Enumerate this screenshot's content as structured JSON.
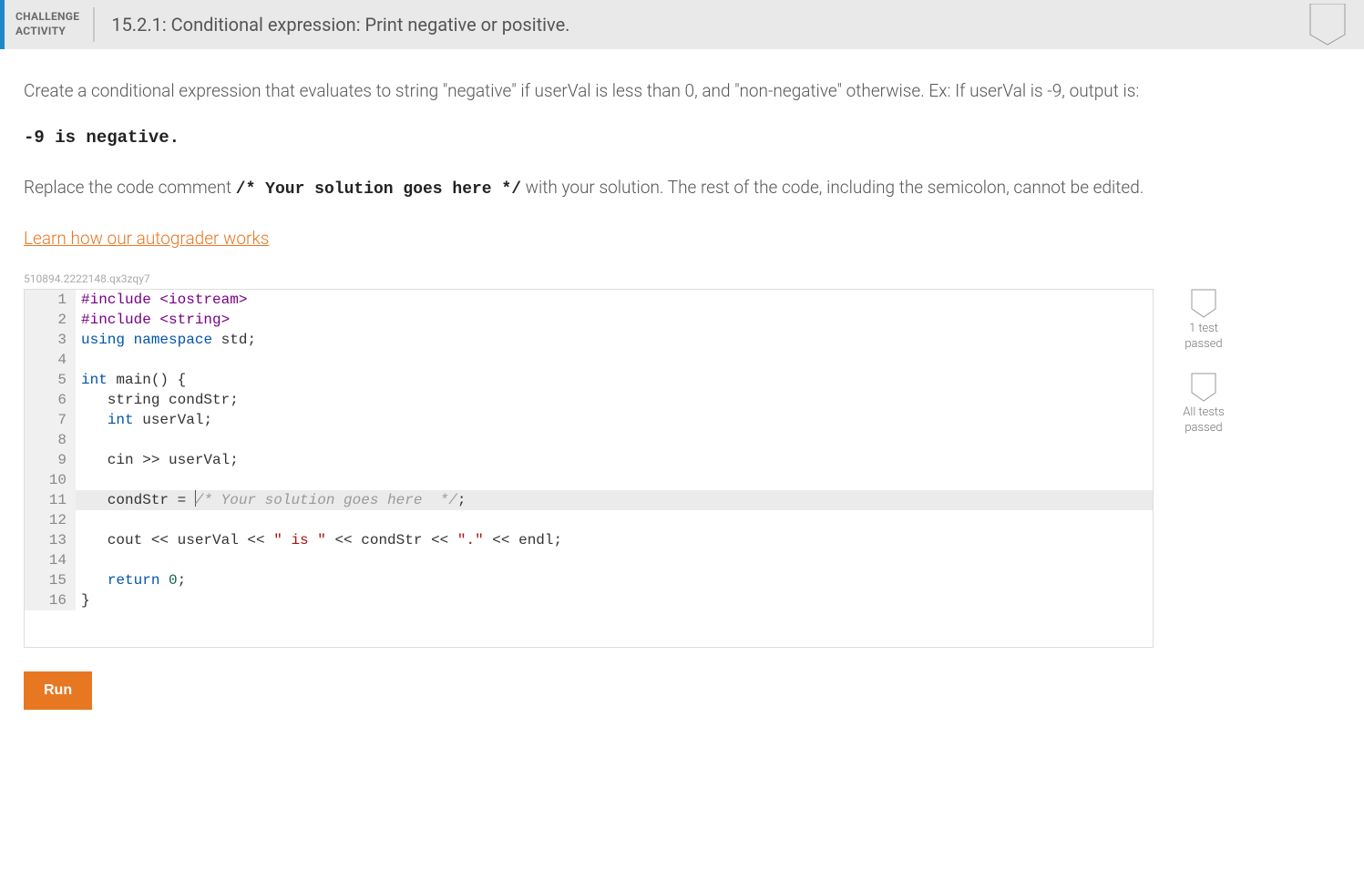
{
  "header": {
    "label_line1": "CHALLENGE",
    "label_line2": "ACTIVITY",
    "title": "15.2.1: Conditional expression: Print negative or positive."
  },
  "instructions": {
    "p1": "Create a conditional expression that evaluates to string \"negative\" if userVal is less than 0, and \"non-negative\" otherwise. Ex: If userVal is -9, output is:",
    "example": "-9 is negative.",
    "p2a": "Replace the code comment ",
    "p2code": "/* Your solution goes here */",
    "p2b": " with your solution. The rest of the code, including the semicolon, cannot be edited."
  },
  "learn_link": "Learn how our autograder works",
  "hash": "510894.2222148.qx3zqy7",
  "code": {
    "active_line": 11,
    "lines": [
      {
        "n": 1,
        "segs": [
          {
            "t": "#include <iostream>",
            "c": "kw-pre"
          }
        ]
      },
      {
        "n": 2,
        "segs": [
          {
            "t": "#include <string>",
            "c": "kw-pre"
          }
        ]
      },
      {
        "n": 3,
        "segs": [
          {
            "t": "using",
            "c": "kw-blue"
          },
          {
            "t": " "
          },
          {
            "t": "namespace",
            "c": "kw-blue"
          },
          {
            "t": " std;"
          }
        ]
      },
      {
        "n": 4,
        "segs": [
          {
            "t": ""
          }
        ]
      },
      {
        "n": 5,
        "segs": [
          {
            "t": "int",
            "c": "kw-type"
          },
          {
            "t": " main() {"
          }
        ]
      },
      {
        "n": 6,
        "segs": [
          {
            "t": "   string condStr;"
          }
        ]
      },
      {
        "n": 7,
        "segs": [
          {
            "t": "   "
          },
          {
            "t": "int",
            "c": "kw-type"
          },
          {
            "t": " userVal;"
          }
        ]
      },
      {
        "n": 8,
        "segs": [
          {
            "t": ""
          }
        ]
      },
      {
        "n": 9,
        "segs": [
          {
            "t": "   cin >> userVal;"
          }
        ]
      },
      {
        "n": 10,
        "segs": [
          {
            "t": ""
          }
        ]
      },
      {
        "n": 11,
        "segs": [
          {
            "t": "   condStr = "
          },
          {
            "cursor": true
          },
          {
            "t": "/* Your solution goes here  */",
            "c": "comment"
          },
          {
            "t": ";"
          }
        ]
      },
      {
        "n": 12,
        "segs": [
          {
            "t": ""
          }
        ]
      },
      {
        "n": 13,
        "segs": [
          {
            "t": "   cout << userVal << "
          },
          {
            "t": "\" is \"",
            "c": "str"
          },
          {
            "t": " << condStr << "
          },
          {
            "t": "\".\"",
            "c": "str"
          },
          {
            "t": " << endl;"
          }
        ]
      },
      {
        "n": 14,
        "segs": [
          {
            "t": ""
          }
        ]
      },
      {
        "n": 15,
        "segs": [
          {
            "t": "   "
          },
          {
            "t": "return",
            "c": "kw-blue"
          },
          {
            "t": " "
          },
          {
            "t": "0",
            "c": "kw-num"
          },
          {
            "t": ";"
          }
        ]
      },
      {
        "n": 16,
        "segs": [
          {
            "t": "}"
          }
        ]
      }
    ]
  },
  "sidebar": {
    "badge1_line1": "1 test",
    "badge1_line2": "passed",
    "badge2_line1": "All tests",
    "badge2_line2": "passed"
  },
  "run_button": "Run"
}
